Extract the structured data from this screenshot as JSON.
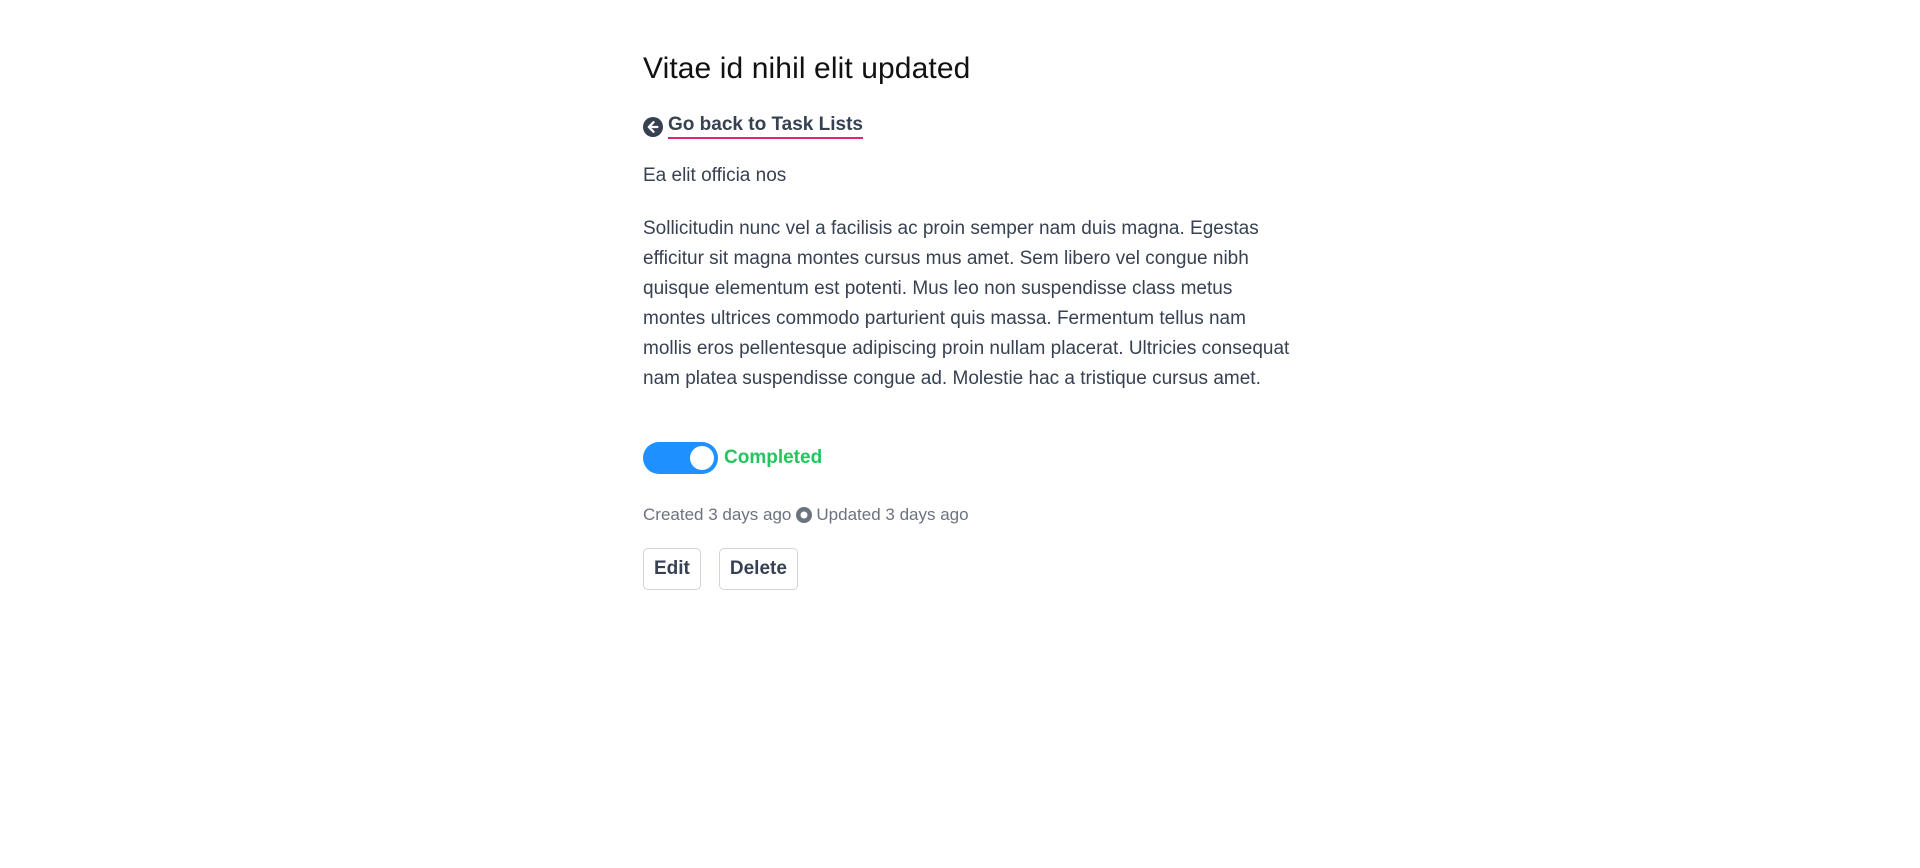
{
  "task": {
    "title": "Vitae id nihil elit updated",
    "back_link": "Go back to Task Lists",
    "subtitle": "Ea elit officia nos",
    "description": "Sollicitudin nunc vel a facilisis ac proin semper nam duis magna. Egestas efficitur sit magna montes cursus mus amet. Sem libero vel congue nibh quisque elementum est potenti. Mus leo non suspendisse class metus montes ultrices commodo parturient quis massa. Fermentum tellus nam mollis eros pellentesque adipiscing proin nullam placerat. Ultricies consequat nam platea suspendisse congue ad. Molestie hac a tristique cursus amet.",
    "completed": true,
    "status_label": "Completed",
    "created": "Created 3 days ago",
    "updated": "Updated 3 days ago"
  },
  "actions": {
    "edit_label": "Edit",
    "delete_label": "Delete"
  },
  "icons": {
    "back": "arrow-circle-left-icon",
    "separator": "dot-circle-icon"
  },
  "colors": {
    "toggle_on": "#1e90ff",
    "status_completed": "#22c55e",
    "link_underline": "#db2777"
  }
}
